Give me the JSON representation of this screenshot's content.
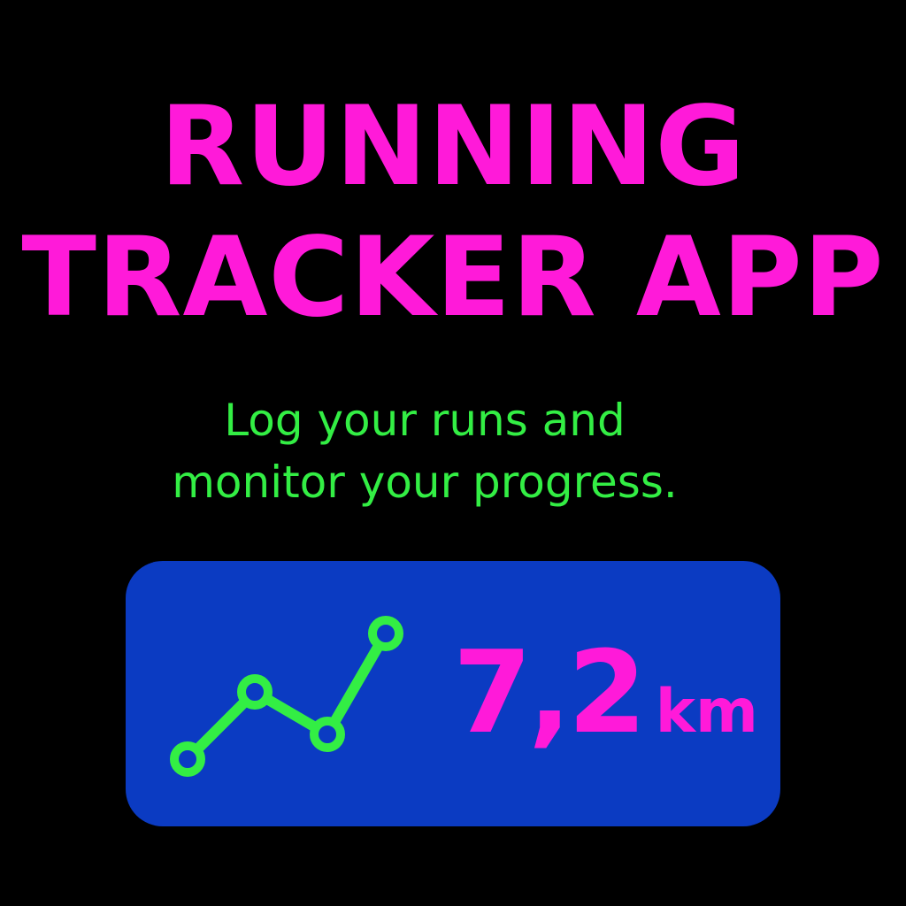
{
  "header": {
    "title_line1": "RUNNING",
    "title_line2": "TRACKER APP"
  },
  "tagline": {
    "line1": "Log your runs and",
    "line2": "monitor your progress."
  },
  "stat_card": {
    "icon": "line-chart-icon",
    "distance_value": "7,2",
    "distance_unit": "km"
  },
  "colors": {
    "background": "#000000",
    "title": "#ff1ad9",
    "tagline": "#33ee44",
    "card": "#0b3bc2",
    "chart_line": "#33ee44",
    "distance": "#ff1ad9"
  }
}
